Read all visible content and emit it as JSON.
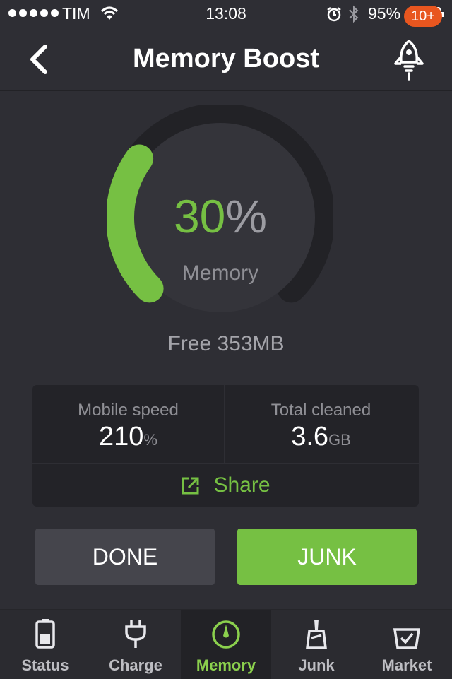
{
  "status_bar": {
    "carrier": "TIM",
    "time": "13:08",
    "battery_percent_text": "95%",
    "battery_level": 0.95
  },
  "nav": {
    "title": "Memory Boost",
    "back_icon": "chevron-left-icon",
    "rocket_icon": "rocket-icon"
  },
  "gauge": {
    "value": "30",
    "unit": "%",
    "label": "Memory",
    "fraction": 0.3,
    "accent": "#76c043"
  },
  "free_text": "Free 353MB",
  "stats": {
    "mobile_speed": {
      "caption": "Mobile speed",
      "value": "210",
      "unit": "%"
    },
    "total_cleaned": {
      "caption": "Total cleaned",
      "value": "3.6",
      "unit": "GB"
    },
    "share_label": "Share"
  },
  "buttons": {
    "done": "DONE",
    "junk": "JUNK"
  },
  "tabs": [
    {
      "label": "Status",
      "icon": "battery-icon"
    },
    {
      "label": "Charge",
      "icon": "plug-icon"
    },
    {
      "label": "Memory",
      "icon": "gauge-icon",
      "active": true
    },
    {
      "label": "Junk",
      "icon": "broom-icon"
    },
    {
      "label": "Market",
      "icon": "cart-icon",
      "badge": "10+"
    }
  ],
  "colors": {
    "accent_green": "#76c043",
    "badge_orange": "#e8561f",
    "background": "#2e2e34"
  }
}
